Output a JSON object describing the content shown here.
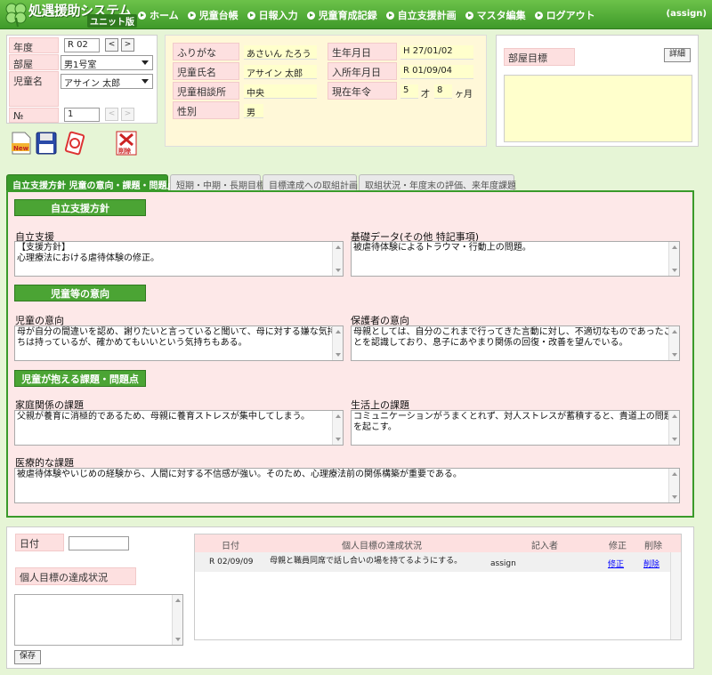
{
  "header": {
    "app_title": "処遇援助システム",
    "app_subtitle": "ユニット版",
    "nav": [
      "ホーム",
      "児童台帳",
      "日報入力",
      "児童育成記録",
      "自立支援計画",
      "マスタ編集",
      "ログアウト"
    ],
    "user": "(assign)"
  },
  "left_form": {
    "year_label": "年度",
    "year_value": "R 02",
    "room_label": "部屋",
    "room_value": "男1号室",
    "child_label": "児童名",
    "child_value": "アサイン 太郎",
    "no_label": "№",
    "no_value": "1",
    "prev": "<",
    "next": ">",
    "icons": {
      "new_label": "New",
      "delete_label": "削除"
    }
  },
  "profile": {
    "furigana_label": "ふりがな",
    "furigana_value": "あさいん たろう",
    "name_label": "児童氏名",
    "name_value": "アサイン 太郎",
    "center_label": "児童相談所",
    "center_value": "中央",
    "sex_label": "性別",
    "sex_value": "男",
    "birth_label": "生年月日",
    "birth_value": "H 27/01/02",
    "entry_label": "入所年月日",
    "entry_value": "R 01/09/04",
    "age_label": "現在年令",
    "age_years": "5",
    "age_years_unit": "才",
    "age_months": "8",
    "age_months_unit": "ヶ月"
  },
  "room_goal": {
    "label": "部屋目標",
    "detail_button": "詳細"
  },
  "tabs": [
    "自立支援方針 児童の意向・課題・問題点",
    "短期・中期・長期目標",
    "目標達成への取組計画",
    "取組状況・年度末の評価、来年度課題"
  ],
  "sections": {
    "policy_head": "自立支援方針",
    "intent_head": "児童等の意向",
    "issues_head": "児童が抱える課題・問題点"
  },
  "fields": {
    "independence_label": "自立支援",
    "independence_text": "【支援方針】\n心理療法における虐待体験の修正。",
    "basic_label": "基礎データ(その他 特記事項)",
    "basic_text": "被虐待体験によるトラウマ・行動上の問題。",
    "child_intent_label": "児童の意向",
    "child_intent_text": "母が自分の間違いを認め、謝りたいと言っていると聞いて、母に対する嫌な気持ちは持っているが、確かめてもいいという気持ちもある。",
    "guardian_intent_label": "保護者の意向",
    "guardian_intent_text": "母親としては、自分のこれまで行ってきた言動に対し、不適切なものであったことを認識しており、息子にあやまり関係の回復・改善を望んでいる。",
    "family_label": "家庭関係の課題",
    "family_text": "父親が養育に消極的であるため、母親に養育ストレスが集中してしまう。",
    "life_label": "生活上の課題",
    "life_text": "コミュニケーションがうまくとれず、対人ストレスが蓄積すると、貴道上の問題を起こす。",
    "medical_label": "医療的な課題",
    "medical_text": "被虐待体験やいじめの経験から、人間に対する不信感が強い。そのため、心理療法前の関係構築が重要である。"
  },
  "bottom": {
    "date_label": "日付",
    "status_label": "個人目標の達成状況",
    "save_button": "保存",
    "table_headers": [
      "日付",
      "個人目標の達成状況",
      "記入者",
      "修正",
      "削除"
    ],
    "rows": [
      {
        "date": "R 02/09/09",
        "status": "母親と職員同席で話し合いの場を持てるようにする。",
        "author": "assign",
        "edit": "修正",
        "delete": "削除"
      }
    ]
  }
}
